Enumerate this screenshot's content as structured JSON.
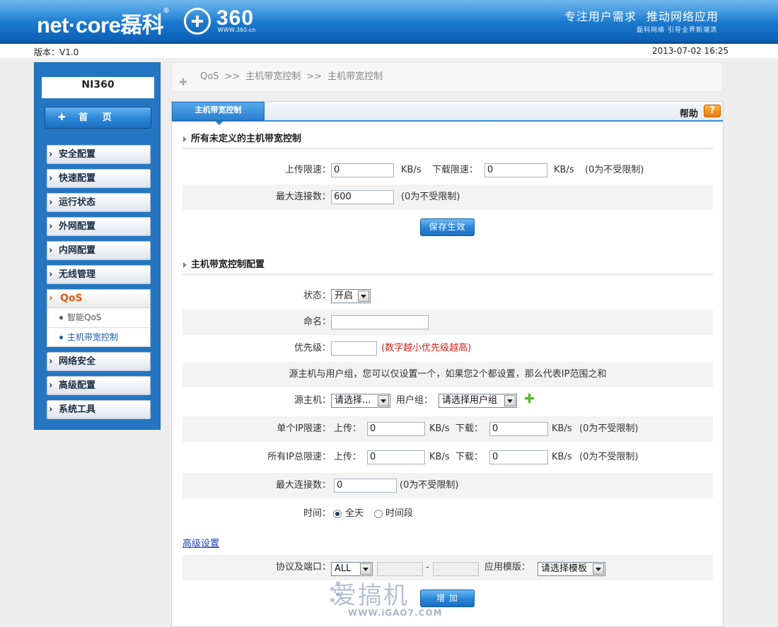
{
  "header": {
    "brand": "net·core",
    "brand_cn": "磊科",
    "brand_mark": "®",
    "partner": "360",
    "partner_url": "WWW.360.cn",
    "slogan_1": "专注用户需求",
    "slogan_2": "推动网络应用",
    "slogan_sub": "磊科网络 引导业界新潮流"
  },
  "version_bar": {
    "version": "版本：V1.0",
    "datetime": "2013-07-02 16:25"
  },
  "sidebar": {
    "title": "NI360",
    "home": "首 页",
    "items": [
      {
        "label": "安全配置"
      },
      {
        "label": "快速配置"
      },
      {
        "label": "运行状态"
      },
      {
        "label": "外网配置"
      },
      {
        "label": "内网配置"
      },
      {
        "label": "无线管理"
      }
    ],
    "qos": {
      "label": "QoS",
      "subitems": [
        {
          "label": "智能QoS"
        },
        {
          "label": "主机带宽控制"
        }
      ]
    },
    "items_after": [
      {
        "label": "网络安全"
      },
      {
        "label": "高级配置"
      },
      {
        "label": "系统工具"
      }
    ],
    "chevron": "›"
  },
  "breadcrumb": {
    "icon": "✚",
    "parts": [
      "QoS",
      "主机带宽控制",
      "主机带宽控制"
    ],
    "separator": ">>"
  },
  "panel": {
    "tab": "主机带宽控制",
    "help_label": "帮助",
    "help_icon": "?"
  },
  "section1": {
    "title": "所有未定义的主机带宽控制",
    "upload_label": "上传限速：",
    "upload_value": "0",
    "unit": "KB/s",
    "download_label": "下载限速：",
    "download_value": "0",
    "no_limit": "(0为不受限制)",
    "maxconn_label": "最大连接数：",
    "maxconn_value": "600",
    "save_button": "保存生效"
  },
  "section2": {
    "title": "主机带宽控制配置",
    "status_label": "状态：",
    "status_value": "开启",
    "name_label": "命名：",
    "name_value": "",
    "priority_label": "优先级：",
    "priority_value": "",
    "priority_hint": "(数字越小优先级越高)",
    "info_text": "源主机与用户组，您可以仅设置一个，如果您2个都设置，那么代表IP范围之和",
    "source_label": "源主机：",
    "source_value": "请选择...",
    "group_label": "用户组：",
    "group_value": "请选择用户组",
    "single_ip_label": "单个IP限速：",
    "upload_short": "上传：",
    "download_short": "下载：",
    "single_up": "0",
    "single_down": "0",
    "all_ip_label": "所有IP总限速：",
    "all_up": "0",
    "all_down": "0",
    "unit": "KB/s",
    "no_limit": "(0为不受限制)",
    "maxconn_label": "最大连接数：",
    "maxconn_value": "0",
    "time_label": "时间：",
    "time_all": "全天",
    "time_range": "时间段",
    "advanced_link": "高级设置",
    "protocol_label": "协议及端口：",
    "protocol_value": "ALL",
    "port_from": "",
    "port_dash": "-",
    "port_to": "",
    "template_label": "应用模版：",
    "template_value": "请选择模板",
    "add_button": "增 加"
  },
  "watermark": {
    "text": "爱搞机",
    "url": "WWW.iGAO7.COM"
  }
}
